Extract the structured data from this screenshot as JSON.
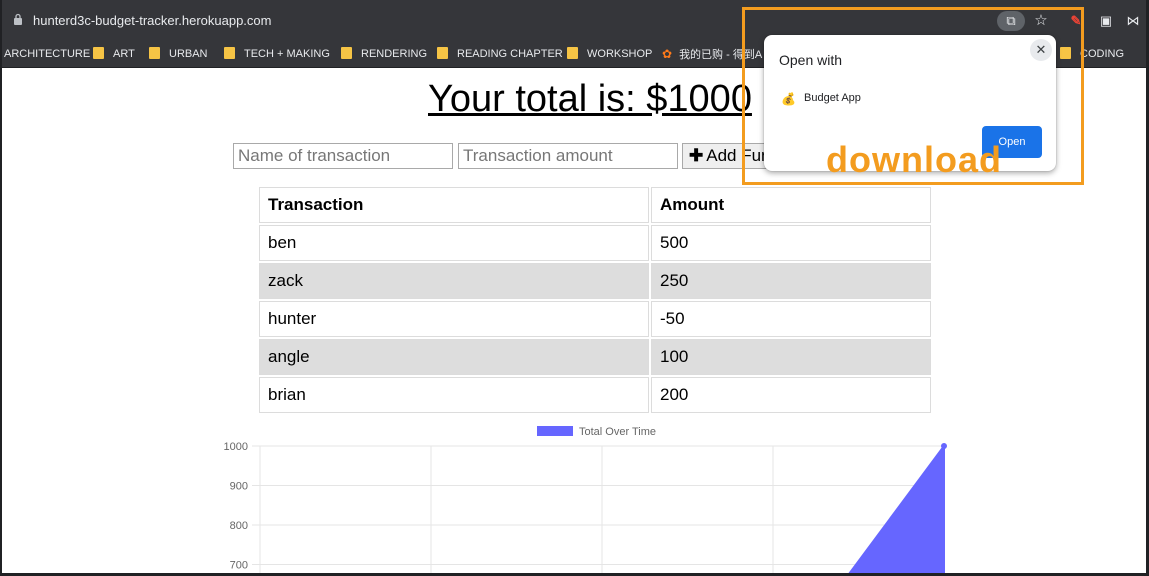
{
  "browser": {
    "url": "hunterd3c-budget-tracker.herokuapp.com",
    "icons": {
      "lock": "lock-icon",
      "open_in_app": "open-in-app-icon",
      "bookmark_star": "star-icon"
    },
    "bookmarks": [
      {
        "label": "ARCHITECTURE",
        "icon": "none"
      },
      {
        "label": "ART",
        "icon": "folder-icon"
      },
      {
        "label": "URBAN",
        "icon": "folder-icon"
      },
      {
        "label": "TECH + MAKING",
        "icon": "folder-icon"
      },
      {
        "label": "RENDERING",
        "icon": "folder-icon"
      },
      {
        "label": "READING CHAPTER",
        "icon": "folder-icon"
      },
      {
        "label": "WORKSHOP",
        "icon": "folder-icon"
      },
      {
        "label": "我的已购 - 得到A",
        "icon": "mascot-icon"
      },
      {
        "label": "CODING",
        "icon": "folder-icon"
      }
    ]
  },
  "page": {
    "total_text": "Your total is: $1000",
    "name_placeholder": "Name of transaction",
    "amount_placeholder": "Transaction amount",
    "add_funds_label": "Add Funds",
    "table": {
      "headers": [
        "Transaction",
        "Amount"
      ],
      "rows": [
        [
          "ben",
          "500"
        ],
        [
          "zack",
          "250"
        ],
        [
          "hunter",
          "-50"
        ],
        [
          "angle",
          "100"
        ],
        [
          "brian",
          "200"
        ]
      ]
    }
  },
  "chart_data": {
    "type": "area",
    "legend": [
      "Total Over Time"
    ],
    "series": [
      {
        "name": "Total Over Time",
        "color": "#6666ff"
      }
    ],
    "y_ticks": [
      1000,
      900,
      800,
      700
    ],
    "grid": true,
    "legend_position": "top-center",
    "visible_points": [
      {
        "x_index": 3.4,
        "y": 650
      },
      {
        "x_index": 4,
        "y": 1000
      }
    ]
  },
  "popup": {
    "title": "Open with",
    "app_name": "Budget App",
    "app_icon": "money-bag-icon",
    "open_label": "Open",
    "close_icon": "close-icon"
  },
  "annotation": {
    "label": "download",
    "color": "#f39c1f"
  }
}
